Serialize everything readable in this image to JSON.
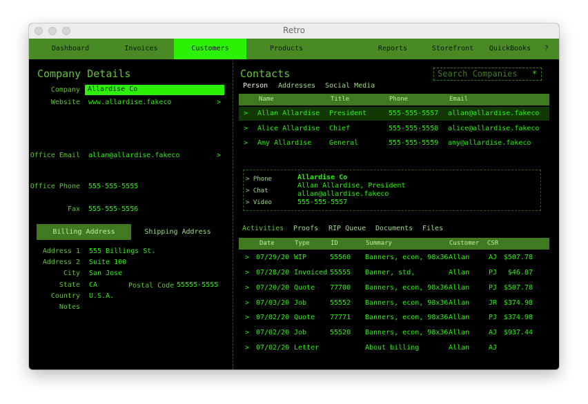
{
  "window": {
    "title": "Retro"
  },
  "nav": {
    "items": [
      "Dashboard",
      "Invoices",
      "Customers",
      "Products",
      "Reports",
      "Storefront",
      "QuickBooks",
      "?"
    ],
    "active": "Customers"
  },
  "company": {
    "heading": "Company Details",
    "company_label": "Company",
    "company_value": "Allardise Co",
    "website_label": "Website",
    "website_value": "www.allardise.fakeco",
    "email_label": "Office Email",
    "email_value": "allan@allardise.fakeco",
    "phone_label": "Office Phone",
    "phone_value": "555-555-5555",
    "fax_label": "Fax",
    "fax_value": "555-555-5556",
    "arrow": ">"
  },
  "address_tabs": {
    "billing": "Billing Address",
    "shipping": "Shipping Address"
  },
  "address": {
    "address1_label": "Address 1",
    "address1_value": "555 Billings St.",
    "address2_label": "Address 2",
    "address2_value": "Suite 100",
    "city_label": "City",
    "city_value": "San Jose",
    "state_label": "State",
    "state_value": "CA",
    "postal_label": "Postal Code",
    "postal_value": "55555-5555",
    "country_label": "Country",
    "country_value": "U.S.A.",
    "notes_label": "Notes"
  },
  "contacts": {
    "heading": "Contacts",
    "search_placeholder": "Search Companies",
    "search_icon": "*",
    "tabs": [
      "Person",
      "Addresses",
      "Social Media"
    ],
    "columns": [
      "Name",
      "Title",
      "Phone",
      "Email"
    ],
    "rows": [
      {
        "name": "Allan Allardise",
        "title": "President",
        "phone": "555-555-5557",
        "email": "allan@allardise.fakeco"
      },
      {
        "name": "Alice Allardise",
        "title": "Chief",
        "phone": "555-555-5558",
        "email": "alice@allardise.fakeco"
      },
      {
        "name": "Amy Allardise",
        "title": "General",
        "phone": "555-555-5559",
        "email": "amy@allardise.fakeco"
      }
    ],
    "row_arrow": ">"
  },
  "contact_card": {
    "actions": [
      "> Phone",
      "> Chat",
      "> Video"
    ],
    "lines": [
      "Allardise Co",
      "Allan Allardise, President",
      "allan@allardise.fakeco",
      "555-555-5557"
    ]
  },
  "activity": {
    "tabs": [
      "Activities",
      "Proofs",
      "RIP Queue",
      "Documents",
      "Files"
    ],
    "columns": [
      "Date",
      "Type",
      "ID",
      "Summary",
      "Customer",
      "CSR"
    ],
    "rows": [
      {
        "date": "07/29/20",
        "type": "WIP",
        "id": "55560",
        "summary": "Banners, econ, 98x36",
        "customer": "Allan",
        "csr": "AJ",
        "amount": "$507.78"
      },
      {
        "date": "07/28/20",
        "type": "Invoiced",
        "id": "55555",
        "summary": "Banner, std,",
        "customer": "Allan",
        "csr": "PJ",
        "amount": "$46.87"
      },
      {
        "date": "07/20/20",
        "type": "Quote",
        "id": "77700",
        "summary": "Banners, econ, 98x36",
        "customer": "Allan",
        "csr": "PJ",
        "amount": "$507.78"
      },
      {
        "date": "07/03/20",
        "type": "Job",
        "id": "55552",
        "summary": "Banners, econ, 98x36",
        "customer": "Allan",
        "csr": "JR",
        "amount": "$374.98"
      },
      {
        "date": "07/02/20",
        "type": "Quote",
        "id": "77771",
        "summary": "Banners, econ, 98x36",
        "customer": "Allan",
        "csr": "PJ",
        "amount": "$374.98"
      },
      {
        "date": "07/02/20",
        "type": "Job",
        "id": "55520",
        "summary": "Banners, econ, 98x36",
        "customer": "Allan",
        "csr": "AJ",
        "amount": "$937.44"
      },
      {
        "date": "07/02/20",
        "type": "Letter",
        "id": "",
        "summary": "About billing",
        "customer": "Allan",
        "csr": "AJ",
        "amount": ""
      }
    ],
    "row_arrow": ">"
  },
  "colors": {
    "accent": "#2bf20a",
    "nav_bg": "#4a8a25",
    "nav_active": "#2cf006",
    "background": "#000000"
  }
}
